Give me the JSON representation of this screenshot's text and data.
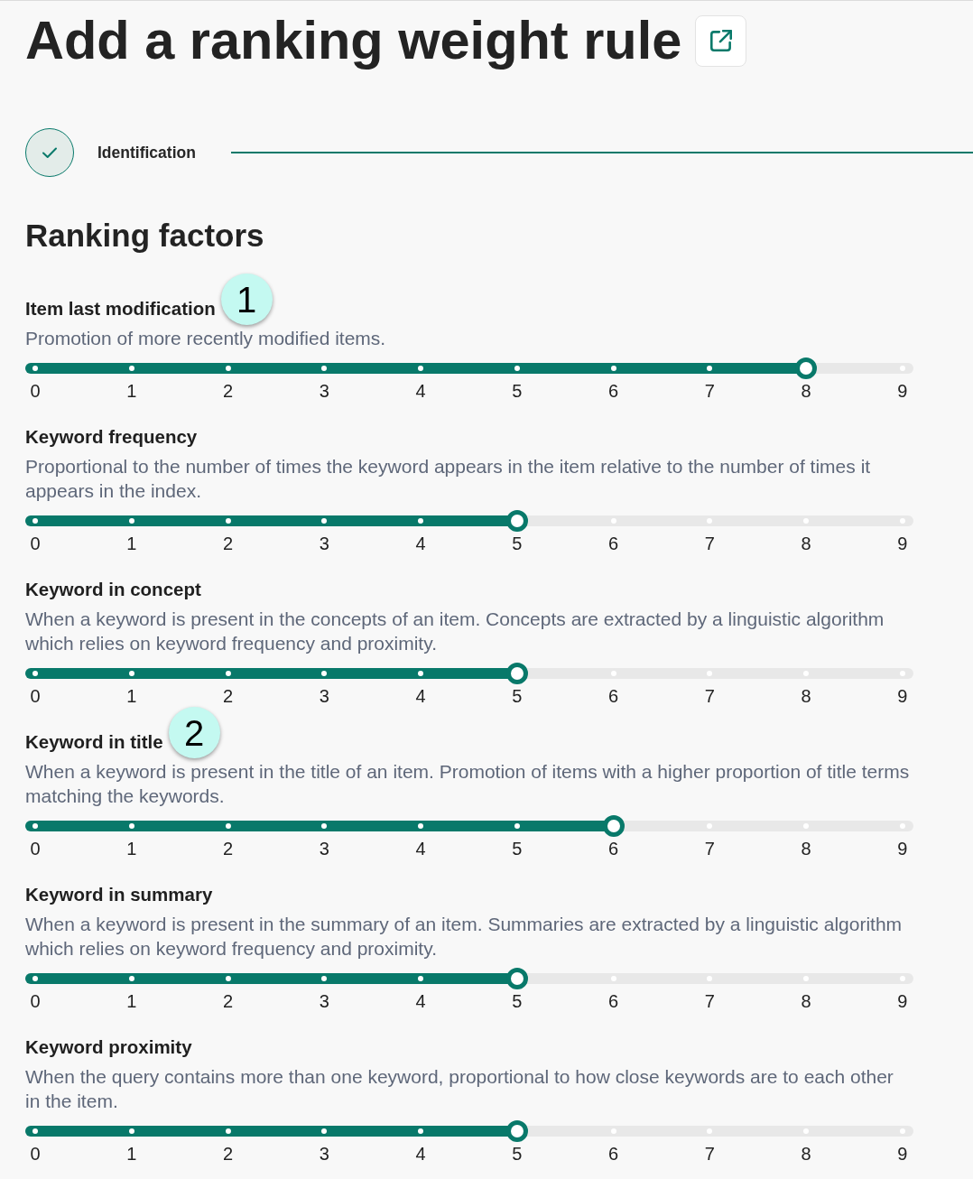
{
  "page": {
    "title": "Add a ranking weight rule"
  },
  "steps": [
    {
      "label": "Identification",
      "completed": true
    }
  ],
  "section": {
    "title": "Ranking factors"
  },
  "factors": [
    {
      "name": "Item last modification",
      "callout": "1",
      "description": "Promotion of more recently modified items.",
      "level": 0.8889,
      "ticks": [
        "0",
        "1",
        "2",
        "3",
        "4",
        "5",
        "6",
        "7",
        "8",
        "9"
      ]
    },
    {
      "name": "Keyword frequency",
      "description": "Proportional to the number of times the keyword appears in the item relative to the number of times it appears in the index.",
      "level": 0.5556,
      "ticks": [
        "0",
        "1",
        "2",
        "3",
        "4",
        "5",
        "6",
        "7",
        "8",
        "9"
      ]
    },
    {
      "name": "Keyword in concept",
      "description": "When a keyword is present in the concepts of an item. Concepts are extracted by a linguistic algorithm which relies on keyword frequency and proximity.",
      "level": 0.5556,
      "ticks": [
        "0",
        "1",
        "2",
        "3",
        "4",
        "5",
        "6",
        "7",
        "8",
        "9"
      ]
    },
    {
      "name": "Keyword in title",
      "callout": "2",
      "description": "When a keyword is present in the title of an item. Promotion of items with a higher proportion of title terms matching the keywords.",
      "level": 0.6667,
      "ticks": [
        "0",
        "1",
        "2",
        "3",
        "4",
        "5",
        "6",
        "7",
        "8",
        "9"
      ]
    },
    {
      "name": "Keyword in summary",
      "description": "When a keyword is present in the summary of an item. Summaries are extracted by a linguistic algorithm which relies on keyword frequency and proximity.",
      "level": 0.5556,
      "ticks": [
        "0",
        "1",
        "2",
        "3",
        "4",
        "5",
        "6",
        "7",
        "8",
        "9"
      ]
    },
    {
      "name": "Keyword proximity",
      "description": "When the query contains more than one keyword, proportional to how close keywords are to each other in the item.",
      "level": 0.5556,
      "ticks": [
        "0",
        "1",
        "2",
        "3",
        "4",
        "5",
        "6",
        "7",
        "8",
        "9"
      ]
    }
  ]
}
